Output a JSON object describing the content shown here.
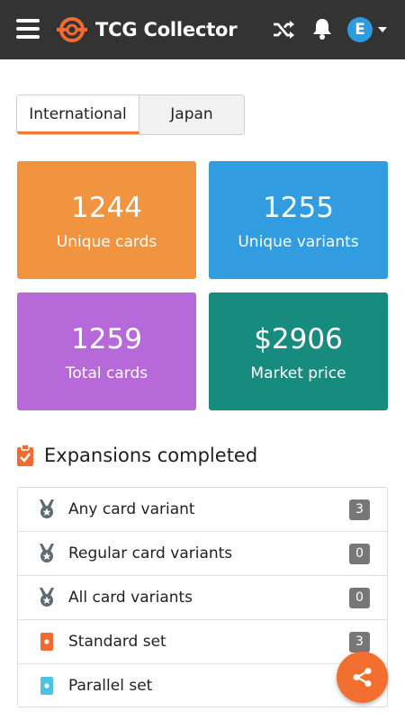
{
  "header": {
    "app_title": "TCG Collector",
    "avatar_letter": "E",
    "icons": [
      "menu-icon",
      "logo-icon",
      "shuffle-icon",
      "bell-icon",
      "caret-down-icon"
    ]
  },
  "tabs": [
    {
      "label": "International",
      "active": true
    },
    {
      "label": "Japan",
      "active": false
    }
  ],
  "stats": [
    {
      "value": "1244",
      "label": "Unique cards",
      "color": "#f19440"
    },
    {
      "value": "1255",
      "label": "Unique variants",
      "color": "#319de0"
    },
    {
      "value": "1259",
      "label": "Total cards",
      "color": "#b768d9"
    },
    {
      "value": "$2906",
      "label": "Market price",
      "color": "#178c7e"
    }
  ],
  "expansions": {
    "title": "Expansions completed",
    "rows": [
      {
        "label": "Any card variant",
        "count": "3",
        "icon": "medal-icon"
      },
      {
        "label": "Regular card variants",
        "count": "0",
        "icon": "medal-icon"
      },
      {
        "label": "All card variants",
        "count": "0",
        "icon": "medal-icon"
      },
      {
        "label": "Standard set",
        "count": "3",
        "icon": "standard-set-icon"
      },
      {
        "label": "Parallel set",
        "count": "",
        "icon": "parallel-set-icon"
      }
    ]
  },
  "colors": {
    "accent": "#f36f30",
    "header_bg": "#333333",
    "badge": "#777777"
  }
}
